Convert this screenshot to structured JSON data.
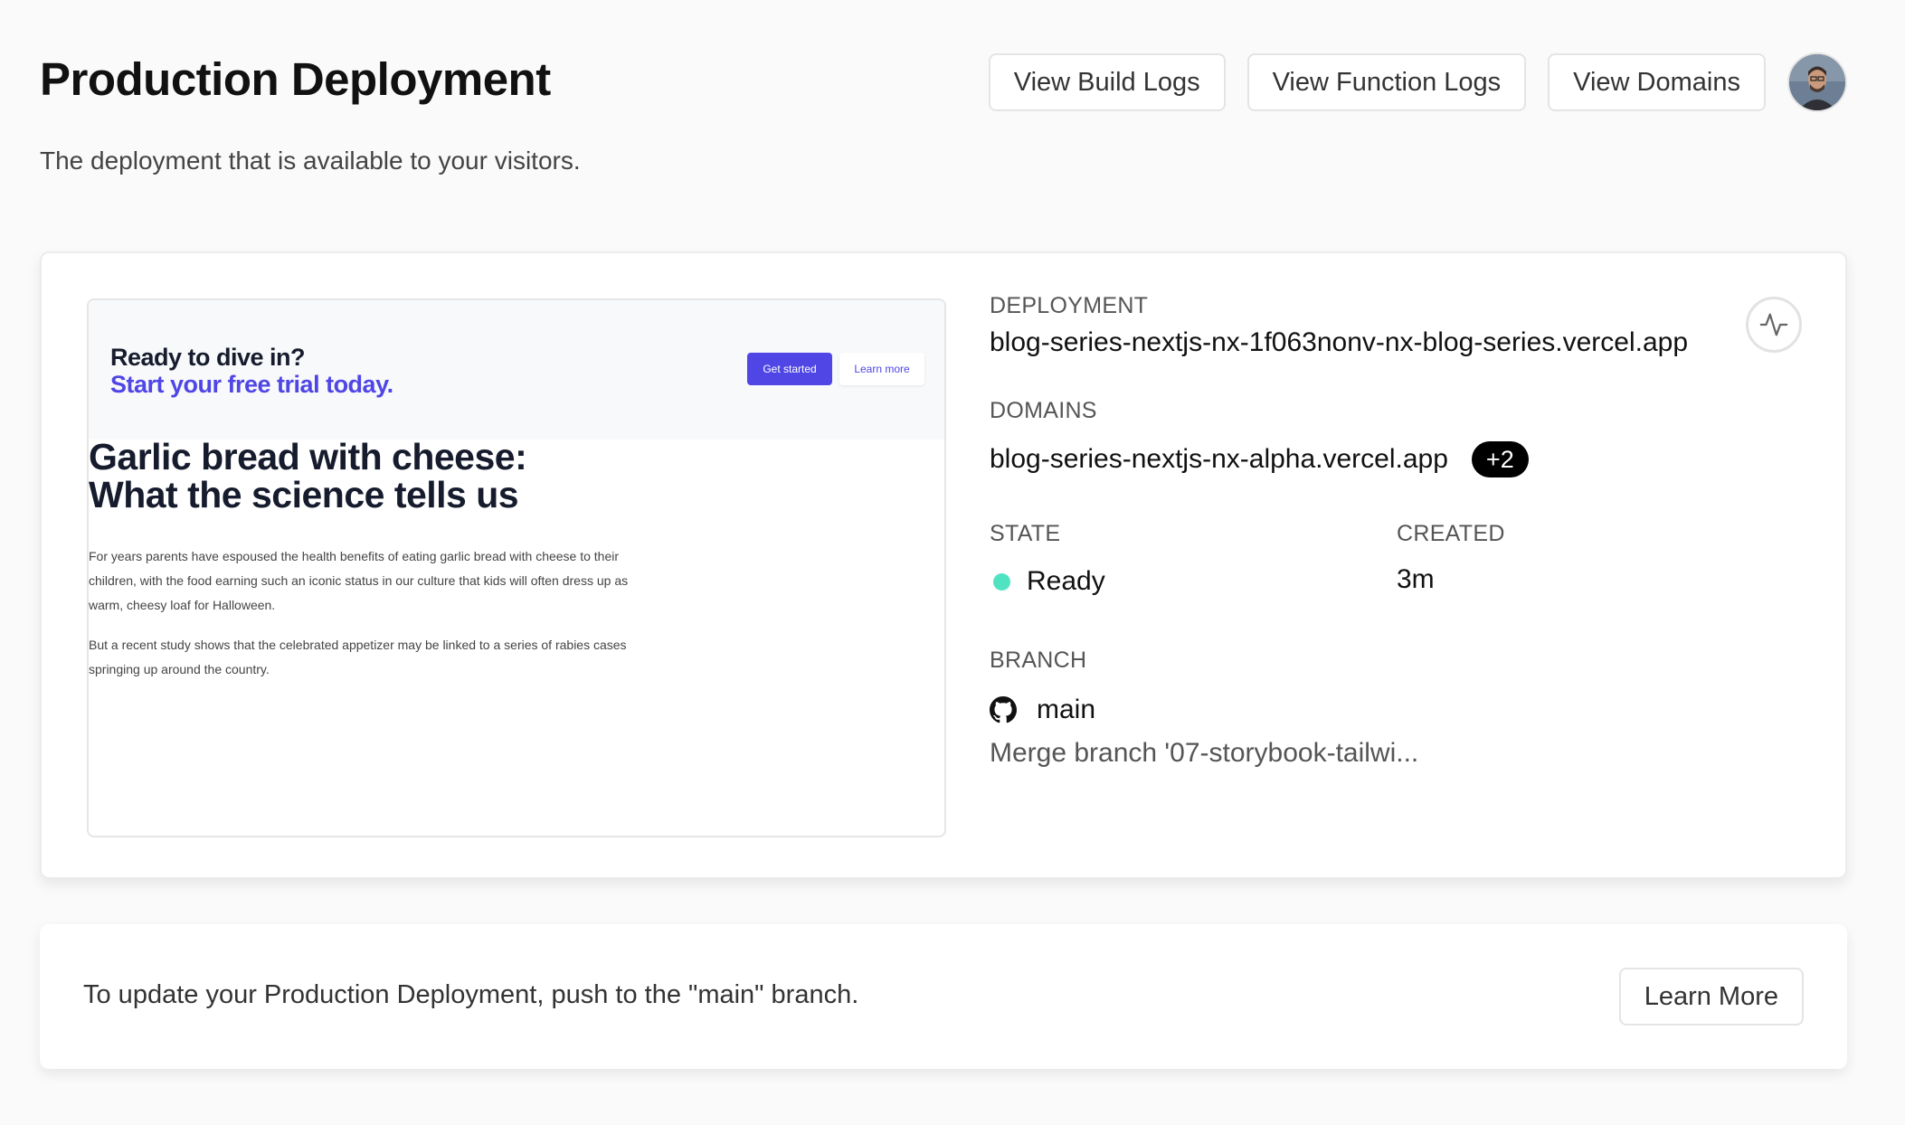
{
  "header": {
    "title": "Production Deployment",
    "subtitle": "The deployment that is available to your visitors.",
    "actions": {
      "build_logs": "View Build Logs",
      "function_logs": "View Function Logs",
      "domains": "View Domains"
    }
  },
  "preview": {
    "banner_line1": "Ready to dive in?",
    "banner_line2": "Start your free trial today.",
    "primary_button": "Get started",
    "secondary_button": "Learn more",
    "article_title_line1": "Garlic bread with cheese:",
    "article_title_line2": "What the science tells us",
    "paragraph1": "For years parents have espoused the health benefits of eating garlic bread with cheese to their children, with the food earning such an iconic status in our culture that kids will often dress up as warm, cheesy loaf for Halloween.",
    "paragraph2": "But a recent study shows that the celebrated appetizer may be linked to a series of rabies cases springing up around the country.",
    "colors": {
      "accent": "#4f46e5",
      "heading": "#161c2d"
    }
  },
  "deployment": {
    "deployment_label": "DEPLOYMENT",
    "deployment_url": "blog-series-nextjs-nx-1f063nonv-nx-blog-series.vercel.app",
    "domains_label": "DOMAINS",
    "domain": "blog-series-nextjs-nx-alpha.vercel.app",
    "domains_badge": "+2",
    "state_label": "STATE",
    "state": "Ready",
    "state_color": "#50e3c2",
    "created_label": "CREATED",
    "created": "3m",
    "branch_label": "BRANCH",
    "branch": "main",
    "commit_message": "Merge branch '07-storybook-tailwi...",
    "branch_icon": "github-icon",
    "activity_icon": "activity-icon"
  },
  "footer": {
    "message": "To update your Production Deployment, push to the \"main\" branch.",
    "learn_more": "Learn More"
  }
}
